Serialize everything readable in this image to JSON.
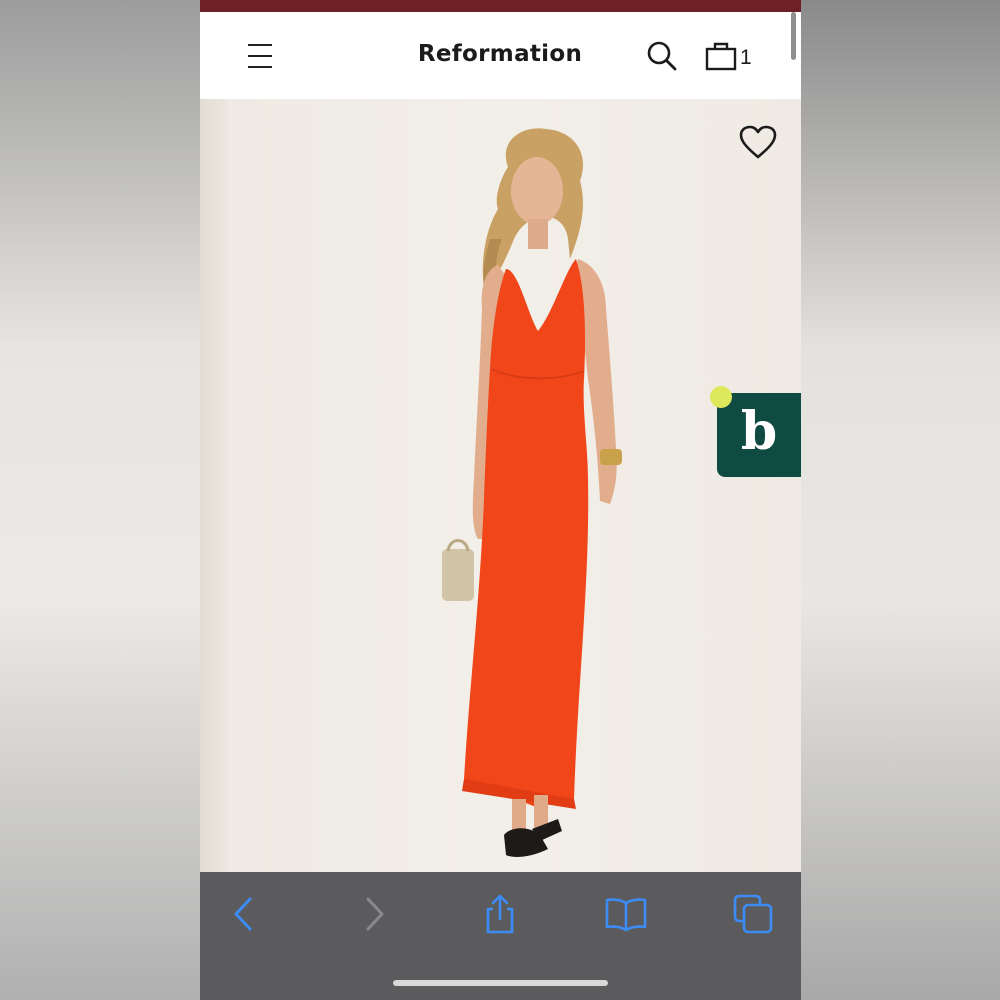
{
  "header": {
    "brand": "Reformation",
    "cart_count": "1"
  },
  "icons": {
    "menu": "hamburger-menu-icon",
    "search": "search-icon",
    "bag": "shopping-bag-icon",
    "wishlist": "heart-icon",
    "widget": "b-chat-widget",
    "toolbar": [
      "back-arrow-icon",
      "forward-arrow-icon",
      "share-icon",
      "bookmarks-icon",
      "tabs-icon"
    ]
  },
  "widget": {
    "letter": "b"
  },
  "product": {
    "dress_color": "#f0461a"
  },
  "colors": {
    "status_strip": "#6e2026",
    "toolbar_bg": "#5b5b5d",
    "toolbar_icon_active": "#3d8cf5",
    "toolbar_icon_disabled": "#8a8a8c",
    "widget_bg": "#0f4a43",
    "widget_dot": "#dde85a"
  }
}
